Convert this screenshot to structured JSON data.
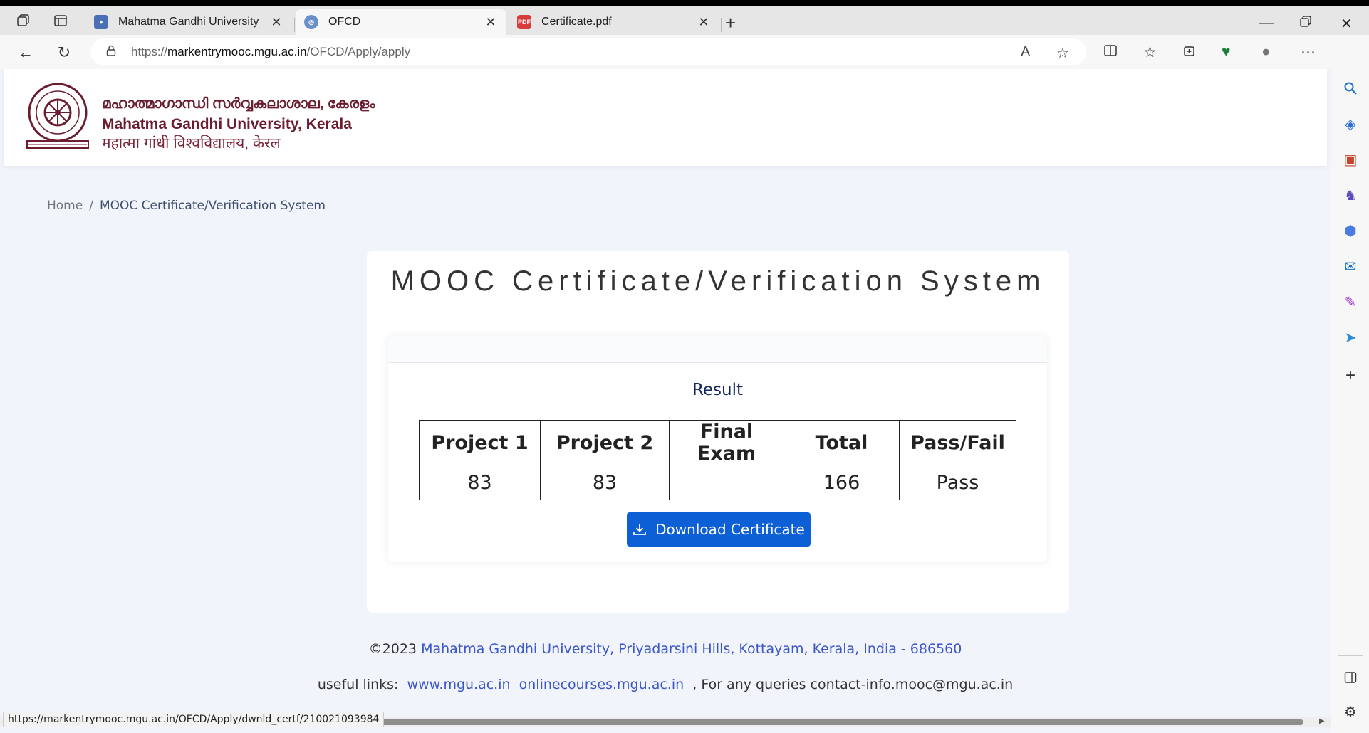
{
  "tabs": [
    {
      "title": "Mahatma Gandhi University",
      "active": false
    },
    {
      "title": "OFCD",
      "active": true
    },
    {
      "title": "Certificate.pdf",
      "active": false
    }
  ],
  "address_bar": {
    "url_prefix": "https://",
    "url_host": "markentrymooc.mgu.ac.in",
    "url_path": "/OFCD/Apply/apply"
  },
  "site": {
    "logo_malayalam": "മഹാത്മാഗാന്ധി സർവ്വകലാശാല, കേരളം",
    "logo_english": "Mahatma Gandhi University, Kerala",
    "logo_hindi": "महात्मा गांधी   विश्वविद्यालय, केरल"
  },
  "breadcrumb": {
    "home": "Home",
    "separator": "/",
    "current": "MOOC Certificate/Verification System"
  },
  "main": {
    "title": "MOOC Certificate/Verification System",
    "result_heading": "Result",
    "table": {
      "headers": [
        "Project 1",
        "Project 2",
        "Final Exam",
        "Total",
        "Pass/Fail"
      ],
      "row": [
        "83",
        "83",
        "",
        "166",
        "Pass"
      ]
    },
    "download_label": "Download Certificate"
  },
  "footer": {
    "copyright_prefix": "©2023 ",
    "address": "Mahatma Gandhi University, Priyadarsini Hills, Kottayam, Kerala, India - 686560",
    "links_label": "useful links:",
    "link1": "www.mgu.ac.in",
    "link2": "onlinecourses.mgu.ac.in",
    "contact": ", For any queries contact-info.mooc@mgu.ac.in"
  },
  "status_bar_url": "https://markentrymooc.mgu.ac.in/OFCD/Apply/dwnld_certf/210021093984",
  "colors": {
    "accent_button": "#0d5fd6",
    "link": "#3b56c8",
    "brand_maroon": "#6b1d2f",
    "page_bg": "#f1f4fb"
  },
  "icons": [
    "workspaces-icon",
    "tab-actions-icon",
    "back-icon",
    "refresh-icon",
    "lock-icon",
    "read-aloud-icon",
    "favorite-star-icon",
    "split-screen-icon",
    "favorites-icon",
    "collections-icon",
    "browser-essentials-icon",
    "profile-icon",
    "more-icon",
    "copilot-icon",
    "search-icon",
    "shopping-icon",
    "tools-icon",
    "games-icon",
    "m365-icon",
    "outlook-icon",
    "designer-icon",
    "send-icon",
    "add-icon",
    "sidebar-toggle-icon",
    "settings-icon",
    "download-icon"
  ]
}
